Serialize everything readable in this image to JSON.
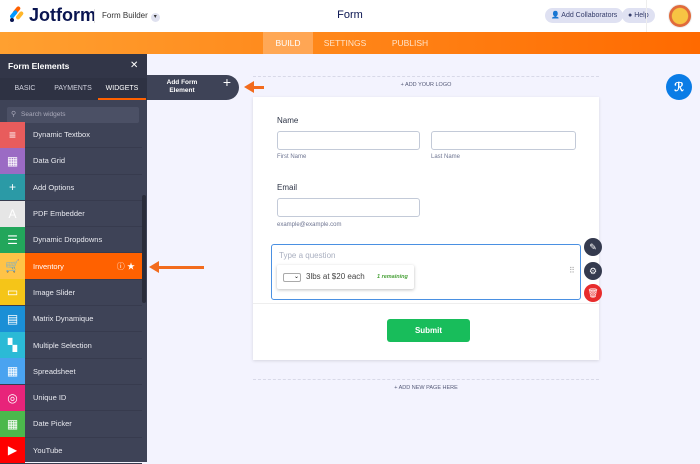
{
  "header": {
    "brand": "Jotform",
    "app_switcher": "Form Builder",
    "title": "Form",
    "collaborators": "Add Collaborators",
    "help": "Help"
  },
  "nav": {
    "tabs": [
      "BUILD",
      "SETTINGS",
      "PUBLISH"
    ],
    "active": "BUILD"
  },
  "sidebar": {
    "title": "Form Elements",
    "tabs": [
      "BASIC",
      "PAYMENTS",
      "WIDGETS"
    ],
    "active_tab": "WIDGETS",
    "search_placeholder": "Search widgets",
    "items": [
      {
        "label": "Dynamic Textbox",
        "color": "#e85c5c",
        "icon": "≡"
      },
      {
        "label": "Data Grid",
        "color": "#9b6bc4",
        "icon": "▦"
      },
      {
        "label": "Add Options",
        "color": "#2b9aa6",
        "icon": "+"
      },
      {
        "label": "PDF Embedder",
        "color": "#e6e6e6",
        "icon": "A"
      },
      {
        "label": "Dynamic Dropdowns",
        "color": "#22a65b",
        "icon": "☰"
      },
      {
        "label": "Inventory",
        "color": "#ffc347",
        "icon": "🛒"
      },
      {
        "label": "Image Slider",
        "color": "#f5c518",
        "icon": "▭"
      },
      {
        "label": "Matrix Dynamique",
        "color": "#1a8fd6",
        "icon": "▤"
      },
      {
        "label": "Multiple Selection",
        "color": "#2bbad6",
        "icon": "▚"
      },
      {
        "label": "Spreadsheet",
        "color": "#4aa3f0",
        "icon": "▦"
      },
      {
        "label": "Unique ID",
        "color": "#e8247a",
        "icon": "◎"
      },
      {
        "label": "Date Picker",
        "color": "#4cb84c",
        "icon": "▦"
      },
      {
        "label": "YouTube",
        "color": "#ff0000",
        "icon": "▶"
      }
    ],
    "active_item": "Inventory"
  },
  "add_element": {
    "line1": "Add Form",
    "line2": "Element",
    "icon": "+"
  },
  "canvas": {
    "add_logo": "+ ADD YOUR LOGO",
    "add_page": "+ ADD NEW PAGE HERE"
  },
  "form": {
    "name_label": "Name",
    "first_sub": "First Name",
    "last_sub": "Last Name",
    "email_label": "Email",
    "email_sub": "example@example.com",
    "question_placeholder": "Type a question",
    "inventory_option": "3lbs at $20 each",
    "remaining": "1 remaining",
    "submit": "Submit"
  },
  "colors": {
    "accent": "#ff6100",
    "submit": "#18bd5b",
    "selection": "#4a90e2"
  }
}
